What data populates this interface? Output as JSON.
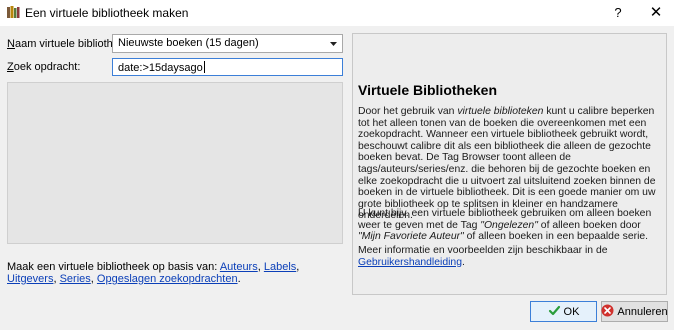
{
  "window": {
    "title": "Een virtuele bibliotheek maken",
    "help_button": "?",
    "close_button": "✕"
  },
  "form": {
    "name_label": "Naam virtuele bibliotheek:",
    "name_value": "Nieuwste boeken (15 dagen)",
    "search_label": "Zoek opdracht:",
    "search_value": "date:>15daysago"
  },
  "based_on": {
    "prefix": "Maak een virtuele bibliotheek op basis van:",
    "links": [
      "Auteurs",
      "Labels",
      "Uitgevers",
      "Series",
      "Opgeslagen zoekopdrachten"
    ],
    "suffix": "."
  },
  "help": {
    "title": "Virtuele Bibliotheken",
    "p1_a": "Door het gebruik van ",
    "p1_em": "virtuele biblioteken",
    "p1_b": " kunt u calibre beperken tot het alleen tonen van de boeken die overeenkomen met een zoekopdracht. Wanneer een virtuele bibliotheek gebruikt wordt, beschouwt calibre dit als een bibliotheek die alleen de gezochte boeken bevat. De Tag Browser toont alleen de tags/auteurs/series/enz. die behoren bij de gezochte boeken en elke zoekopdracht die u uitvoert zal uitsluitend zoeken binnen de boeken in de virtuele bibliotheek. Dit is een goede manier om uw grote bibliotheek op te splitsen in kleiner en handzamere onderdelen.",
    "p2_a": "U kunt bijv. een virtuele bibliotheek gebruiken om alleen boeken weer te geven met de Tag ",
    "p2_em1": "\"Ongelezen\"",
    "p2_b": " of alleen boeken door ",
    "p2_em2": "\"Mijn Favoriete Auteur\"",
    "p2_c": " of alleen boeken in een bepaalde serie.",
    "p3_a": "Meer informatie en voorbeelden zijn beschikbaar in de ",
    "p3_link": "Gebruikershandleiding",
    "p3_b": "."
  },
  "buttons": {
    "ok": "OK",
    "cancel": "Annuleren"
  },
  "colors": {
    "link": "#0b3fb8",
    "focus_border": "#3c7fd8",
    "ok_icon": "#2a9d3b",
    "cancel_icon": "#d0312d"
  },
  "icons": {
    "app": "books-icon",
    "combo": "dropdown-arrow-icon",
    "ok": "checkmark-icon",
    "cancel": "cancel-icon"
  }
}
